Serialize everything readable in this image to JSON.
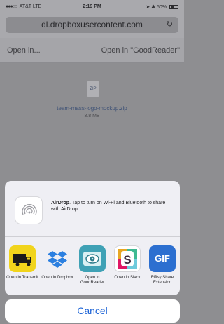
{
  "status_bar": {
    "carrier": "AT&T",
    "network": "LTE",
    "time": "2:19 PM",
    "battery": "50%"
  },
  "browser": {
    "url": "dl.dropboxusercontent.com",
    "open_in_left": "Open in...",
    "open_in_right": "Open in \"GoodReader\""
  },
  "file": {
    "icon_text": "ZIP",
    "name": "team-mass-logo-mockup.zip",
    "size": "3.8 MB"
  },
  "share_sheet": {
    "airdrop_title": "AirDrop",
    "airdrop_text": ". Tap to turn on Wi-Fi and Bluetooth to share with AirDrop.",
    "apps": [
      {
        "label": "Open in Transmit",
        "icon": "transmit-truck-icon"
      },
      {
        "label": "Open in Dropbox",
        "icon": "dropbox-icon"
      },
      {
        "label": "Open in GoodReader",
        "icon": "goodreader-eye-icon"
      },
      {
        "label": "Open in Slack",
        "icon": "slack-icon"
      },
      {
        "label": "Riffsy Share Extension",
        "icon": "riffsy-gif-icon",
        "icon_text": "GIF"
      }
    ],
    "cancel_label": "Cancel"
  },
  "colors": {
    "accent": "#1c63d6",
    "transmit": "#f1d41c",
    "dropbox": "#2b7fe0",
    "goodreader": "#3fa1b5",
    "riffsy": "#2c6fd0"
  }
}
